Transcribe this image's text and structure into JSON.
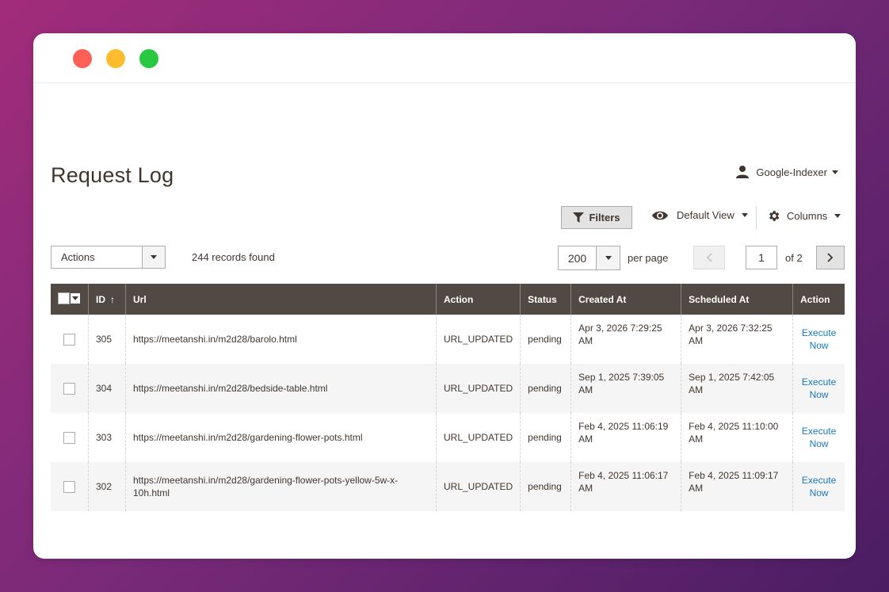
{
  "page": {
    "title": "Request Log",
    "account_name": "Google-Indexer"
  },
  "toolbar": {
    "filters_label": "Filters",
    "view_label": "Default View",
    "columns_label": "Columns",
    "actions_label": "Actions",
    "records_found": "244 records found",
    "per_page_value": "200",
    "per_page_label": "per page",
    "current_page": "1",
    "page_of": "of 2"
  },
  "table": {
    "headers": {
      "id": "ID",
      "id_sort": "↑",
      "url": "Url",
      "action": "Action",
      "status": "Status",
      "created_at": "Created At",
      "scheduled_at": "Scheduled At",
      "row_action": "Action"
    },
    "rows": [
      {
        "id": "305",
        "url": "https://meetanshi.in/m2d28/barolo.html",
        "action": "URL_UPDATED",
        "status": "pending",
        "created_at": "Apr 3, 2026 7:29:25 AM",
        "scheduled_at": "Apr 3, 2026 7:32:25 AM",
        "execute": "Execute Now"
      },
      {
        "id": "304",
        "url": "https://meetanshi.in/m2d28/bedside-table.html",
        "action": "URL_UPDATED",
        "status": "pending",
        "created_at": "Sep 1, 2025 7:39:05 AM",
        "scheduled_at": "Sep 1, 2025 7:42:05 AM",
        "execute": "Execute Now"
      },
      {
        "id": "303",
        "url": "https://meetanshi.in/m2d28/gardening-flower-pots.html",
        "action": "URL_UPDATED",
        "status": "pending",
        "created_at": "Feb 4, 2025 11:06:19 AM",
        "scheduled_at": "Feb 4, 2025 11:10:00 AM",
        "execute": "Execute Now"
      },
      {
        "id": "302",
        "url": "https://meetanshi.in/m2d28/gardening-flower-pots-yellow-5w-x-10h.html",
        "action": "URL_UPDATED",
        "status": "pending",
        "created_at": "Feb 4, 2025 11:06:17 AM",
        "scheduled_at": "Feb 4, 2025 11:09:17 AM",
        "execute": "Execute Now"
      }
    ]
  },
  "colors": {
    "header_bg": "#514943",
    "link": "#1979c3",
    "text": "#41362f"
  }
}
